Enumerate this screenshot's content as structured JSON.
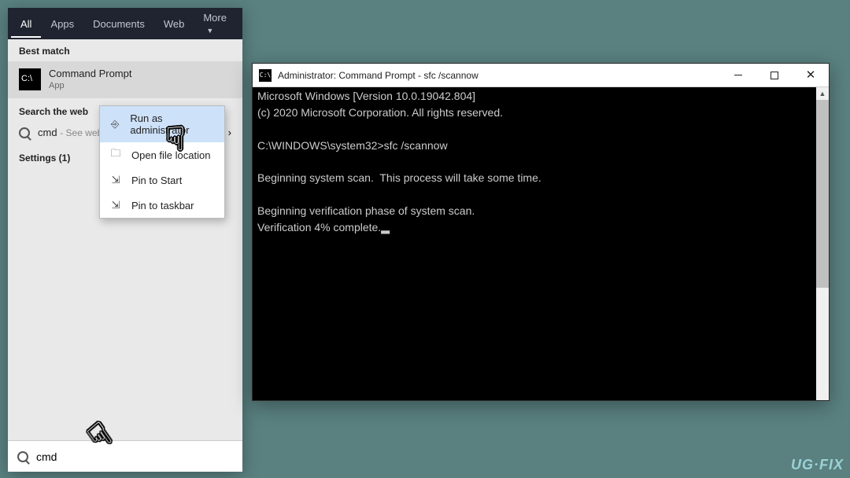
{
  "search_panel": {
    "tabs": {
      "all": "All",
      "apps": "Apps",
      "documents": "Documents",
      "web": "Web",
      "more": "More"
    },
    "best_match_header": "Best match",
    "best_match": {
      "title": "Command Prompt",
      "subtitle": "App",
      "icon_glyph": "C:\\"
    },
    "search_web": {
      "header": "Search the web",
      "query": "cmd",
      "hint": " - See web"
    },
    "settings_row": "Settings (1)",
    "search_box": {
      "value": "cmd"
    },
    "chevron": "›"
  },
  "context_menu": {
    "items": [
      {
        "icon": "⎆",
        "label": "Run as administrator",
        "active": true
      },
      {
        "icon": "🗀",
        "label": "Open file location",
        "active": false
      },
      {
        "icon": "⇲",
        "label": "Pin to Start",
        "active": false
      },
      {
        "icon": "⇲",
        "label": "Pin to taskbar",
        "active": false
      }
    ]
  },
  "cmd_window": {
    "title": "Administrator: Command Prompt - sfc  /scannow",
    "title_icon_glyph": "C:\\",
    "lines": [
      "Microsoft Windows [Version 10.0.19042.804]",
      "(c) 2020 Microsoft Corporation. All rights reserved.",
      "",
      "C:\\WINDOWS\\system32>sfc /scannow",
      "",
      "Beginning system scan.  This process will take some time.",
      "",
      "Beginning verification phase of system scan.",
      "Verification 4% complete.▂"
    ]
  },
  "watermark": "UG·FIX"
}
